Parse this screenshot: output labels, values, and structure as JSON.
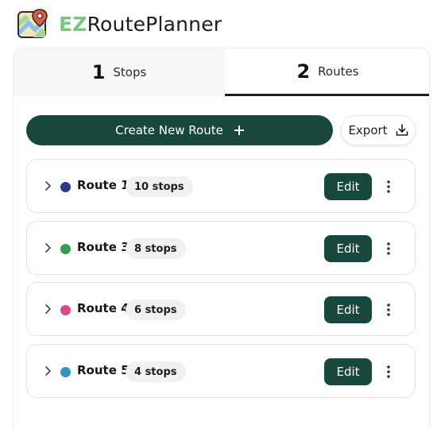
{
  "app": {
    "brand_prefix": "EZ",
    "brand_rest": "RoutePlanner",
    "logo_icon": "map-pin-logo-icon"
  },
  "tabs": [
    {
      "number": "1",
      "label": "Stops",
      "active": false
    },
    {
      "number": "2",
      "label": "Routes",
      "active": true
    }
  ],
  "actions": {
    "create_label": "Create New Route",
    "export_label": "Export"
  },
  "routes": [
    {
      "name": "Route 1",
      "stops": "10 stops",
      "color": "#2b3a8f",
      "edit_label": "Edit"
    },
    {
      "name": "Route 3",
      "stops": "8 stops",
      "color": "#3a9a5c",
      "edit_label": "Edit"
    },
    {
      "name": "Route 4",
      "stops": "6 stops",
      "color": "#d44a8e",
      "edit_label": "Edit"
    },
    {
      "name": "Route 5",
      "stops": "4 stops",
      "color": "#3795c2",
      "edit_label": "Edit"
    }
  ],
  "colors": {
    "primary": "#18473d",
    "brand_accent": "#7cc47f"
  }
}
